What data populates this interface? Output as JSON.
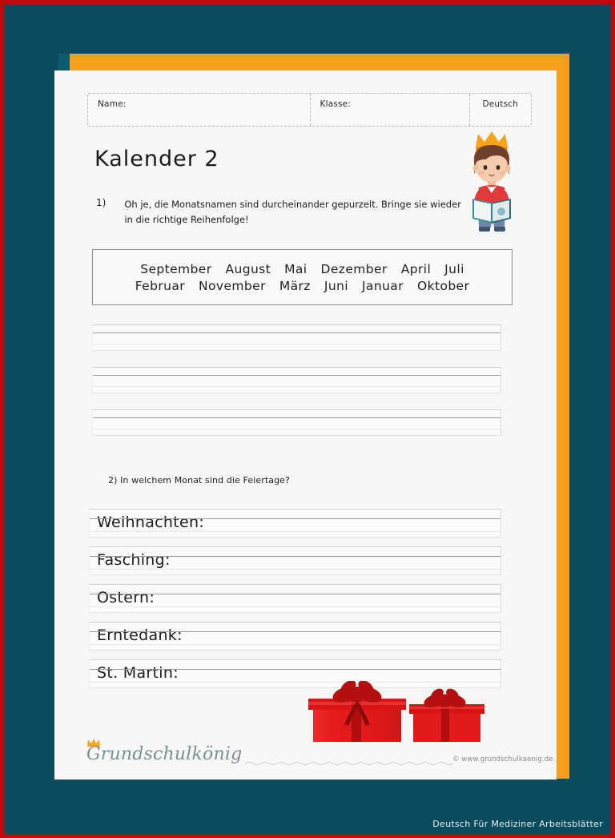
{
  "theme": {
    "background": "#0a4c5e",
    "accent_orange": "#f79f1c",
    "border_red": "#c00a0a",
    "paper": "#f7f7f5",
    "ink": "#1b1b1b"
  },
  "header": {
    "name_label": "Name:",
    "klasse_label": "Klasse:",
    "subject": "Deutsch"
  },
  "title": "Kalender 2",
  "task1": {
    "number": "1)",
    "text": "Oh je, die Monatsnamen sind durcheinander gepurzelt. Bringe sie wieder in die richtige Reihenfolge!"
  },
  "wordbank": {
    "row1": [
      "September",
      "August",
      "Mai",
      "Dezember",
      "April",
      "Juli"
    ],
    "row2": [
      "Februar",
      "November",
      "März",
      "Juni",
      "Januar",
      "Oktober"
    ]
  },
  "answer_lines": [
    "",
    "",
    ""
  ],
  "task2": {
    "text": "2) In welchem Monat sind die Feiertage?"
  },
  "holidays": [
    {
      "label": "Weihnachten:",
      "answer": ""
    },
    {
      "label": "Fasching:",
      "answer": ""
    },
    {
      "label": "Ostern:",
      "answer": ""
    },
    {
      "label": "Erntedank:",
      "answer": ""
    },
    {
      "label": "St. Martin:",
      "answer": ""
    }
  ],
  "illustrations": {
    "boy": "boy-with-crown-reading-book-icon",
    "gifts": "red-gift-boxes-icon"
  },
  "footer": {
    "logo_text": "Grundschulkönig",
    "logo_crown": "crown-icon",
    "url": "© www.grundschulkaenig.de"
  },
  "watermark": "Deutsch Für Mediziner Arbeitsblätter"
}
